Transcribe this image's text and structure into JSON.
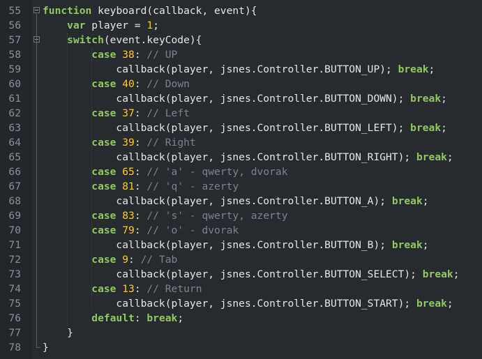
{
  "editor": {
    "lines": [
      {
        "num": "55",
        "tokens": [
          [
            "kw",
            "function"
          ],
          [
            "pl",
            " keyboard(callback, event){"
          ]
        ]
      },
      {
        "num": "56",
        "tokens": [
          [
            "pl",
            "    "
          ],
          [
            "kw",
            "var"
          ],
          [
            "pl",
            " player = "
          ],
          [
            "num",
            "1"
          ],
          [
            "pl",
            ";"
          ]
        ]
      },
      {
        "num": "57",
        "tokens": [
          [
            "pl",
            "    "
          ],
          [
            "kw",
            "switch"
          ],
          [
            "pl",
            "(event.keyCode){"
          ]
        ]
      },
      {
        "num": "58",
        "tokens": [
          [
            "pl",
            "        "
          ],
          [
            "kw",
            "case"
          ],
          [
            "pl",
            " "
          ],
          [
            "num",
            "38"
          ],
          [
            "pl",
            ": "
          ],
          [
            "cm",
            "// UP"
          ]
        ]
      },
      {
        "num": "59",
        "tokens": [
          [
            "pl",
            "            callback(player, jsnes.Controller.BUTTON_UP); "
          ],
          [
            "kw",
            "break"
          ],
          [
            "pl",
            ";"
          ]
        ]
      },
      {
        "num": "60",
        "tokens": [
          [
            "pl",
            "        "
          ],
          [
            "kw",
            "case"
          ],
          [
            "pl",
            " "
          ],
          [
            "num",
            "40"
          ],
          [
            "pl",
            ": "
          ],
          [
            "cm",
            "// Down"
          ]
        ]
      },
      {
        "num": "61",
        "tokens": [
          [
            "pl",
            "            callback(player, jsnes.Controller.BUTTON_DOWN); "
          ],
          [
            "kw",
            "break"
          ],
          [
            "pl",
            ";"
          ]
        ]
      },
      {
        "num": "62",
        "tokens": [
          [
            "pl",
            "        "
          ],
          [
            "kw",
            "case"
          ],
          [
            "pl",
            " "
          ],
          [
            "num",
            "37"
          ],
          [
            "pl",
            ": "
          ],
          [
            "cm",
            "// Left"
          ]
        ]
      },
      {
        "num": "63",
        "tokens": [
          [
            "pl",
            "            callback(player, jsnes.Controller.BUTTON_LEFT); "
          ],
          [
            "kw",
            "break"
          ],
          [
            "pl",
            ";"
          ]
        ]
      },
      {
        "num": "64",
        "tokens": [
          [
            "pl",
            "        "
          ],
          [
            "kw",
            "case"
          ],
          [
            "pl",
            " "
          ],
          [
            "num",
            "39"
          ],
          [
            "pl",
            ": "
          ],
          [
            "cm",
            "// Right"
          ]
        ]
      },
      {
        "num": "65",
        "tokens": [
          [
            "pl",
            "            callback(player, jsnes.Controller.BUTTON_RIGHT); "
          ],
          [
            "kw",
            "break"
          ],
          [
            "pl",
            ";"
          ]
        ]
      },
      {
        "num": "66",
        "tokens": [
          [
            "pl",
            "        "
          ],
          [
            "kw",
            "case"
          ],
          [
            "pl",
            " "
          ],
          [
            "num",
            "65"
          ],
          [
            "pl",
            ": "
          ],
          [
            "cm",
            "// 'a' - qwerty, dvorak"
          ]
        ]
      },
      {
        "num": "67",
        "tokens": [
          [
            "pl",
            "        "
          ],
          [
            "kw",
            "case"
          ],
          [
            "pl",
            " "
          ],
          [
            "num",
            "81"
          ],
          [
            "pl",
            ": "
          ],
          [
            "cm",
            "// 'q' - azerty"
          ]
        ]
      },
      {
        "num": "68",
        "tokens": [
          [
            "pl",
            "            callback(player, jsnes.Controller.BUTTON_A); "
          ],
          [
            "kw",
            "break"
          ],
          [
            "pl",
            ";"
          ]
        ]
      },
      {
        "num": "69",
        "tokens": [
          [
            "pl",
            "        "
          ],
          [
            "kw",
            "case"
          ],
          [
            "pl",
            " "
          ],
          [
            "num",
            "83"
          ],
          [
            "pl",
            ": "
          ],
          [
            "cm",
            "// 's' - qwerty, azerty"
          ]
        ]
      },
      {
        "num": "70",
        "tokens": [
          [
            "pl",
            "        "
          ],
          [
            "kw",
            "case"
          ],
          [
            "pl",
            " "
          ],
          [
            "num",
            "79"
          ],
          [
            "pl",
            ": "
          ],
          [
            "cm",
            "// 'o' - dvorak"
          ]
        ]
      },
      {
        "num": "71",
        "tokens": [
          [
            "pl",
            "            callback(player, jsnes.Controller.BUTTON_B); "
          ],
          [
            "kw",
            "break"
          ],
          [
            "pl",
            ";"
          ]
        ]
      },
      {
        "num": "72",
        "tokens": [
          [
            "pl",
            "        "
          ],
          [
            "kw",
            "case"
          ],
          [
            "pl",
            " "
          ],
          [
            "num",
            "9"
          ],
          [
            "pl",
            ": "
          ],
          [
            "cm",
            "// Tab"
          ]
        ]
      },
      {
        "num": "73",
        "tokens": [
          [
            "pl",
            "            callback(player, jsnes.Controller.BUTTON_SELECT); "
          ],
          [
            "kw",
            "break"
          ],
          [
            "pl",
            ";"
          ]
        ]
      },
      {
        "num": "74",
        "tokens": [
          [
            "pl",
            "        "
          ],
          [
            "kw",
            "case"
          ],
          [
            "pl",
            " "
          ],
          [
            "num",
            "13"
          ],
          [
            "pl",
            ": "
          ],
          [
            "cm",
            "// Return"
          ]
        ]
      },
      {
        "num": "75",
        "tokens": [
          [
            "pl",
            "            callback(player, jsnes.Controller.BUTTON_START); "
          ],
          [
            "kw",
            "break"
          ],
          [
            "pl",
            ";"
          ]
        ]
      },
      {
        "num": "76",
        "tokens": [
          [
            "pl",
            "        "
          ],
          [
            "kw",
            "default"
          ],
          [
            "pl",
            ": "
          ],
          [
            "kw",
            "break"
          ],
          [
            "pl",
            ";"
          ]
        ]
      },
      {
        "num": "77",
        "tokens": [
          [
            "pl",
            "    }"
          ]
        ]
      },
      {
        "num": "78",
        "tokens": [
          [
            "pl",
            "}"
          ]
        ]
      }
    ]
  },
  "colors": {
    "background": "#272a2e",
    "keyword": "#93c763",
    "number": "#ffcd22",
    "comment": "#7a848e",
    "plain": "#e6e6e6",
    "line_number": "#8a9099"
  }
}
